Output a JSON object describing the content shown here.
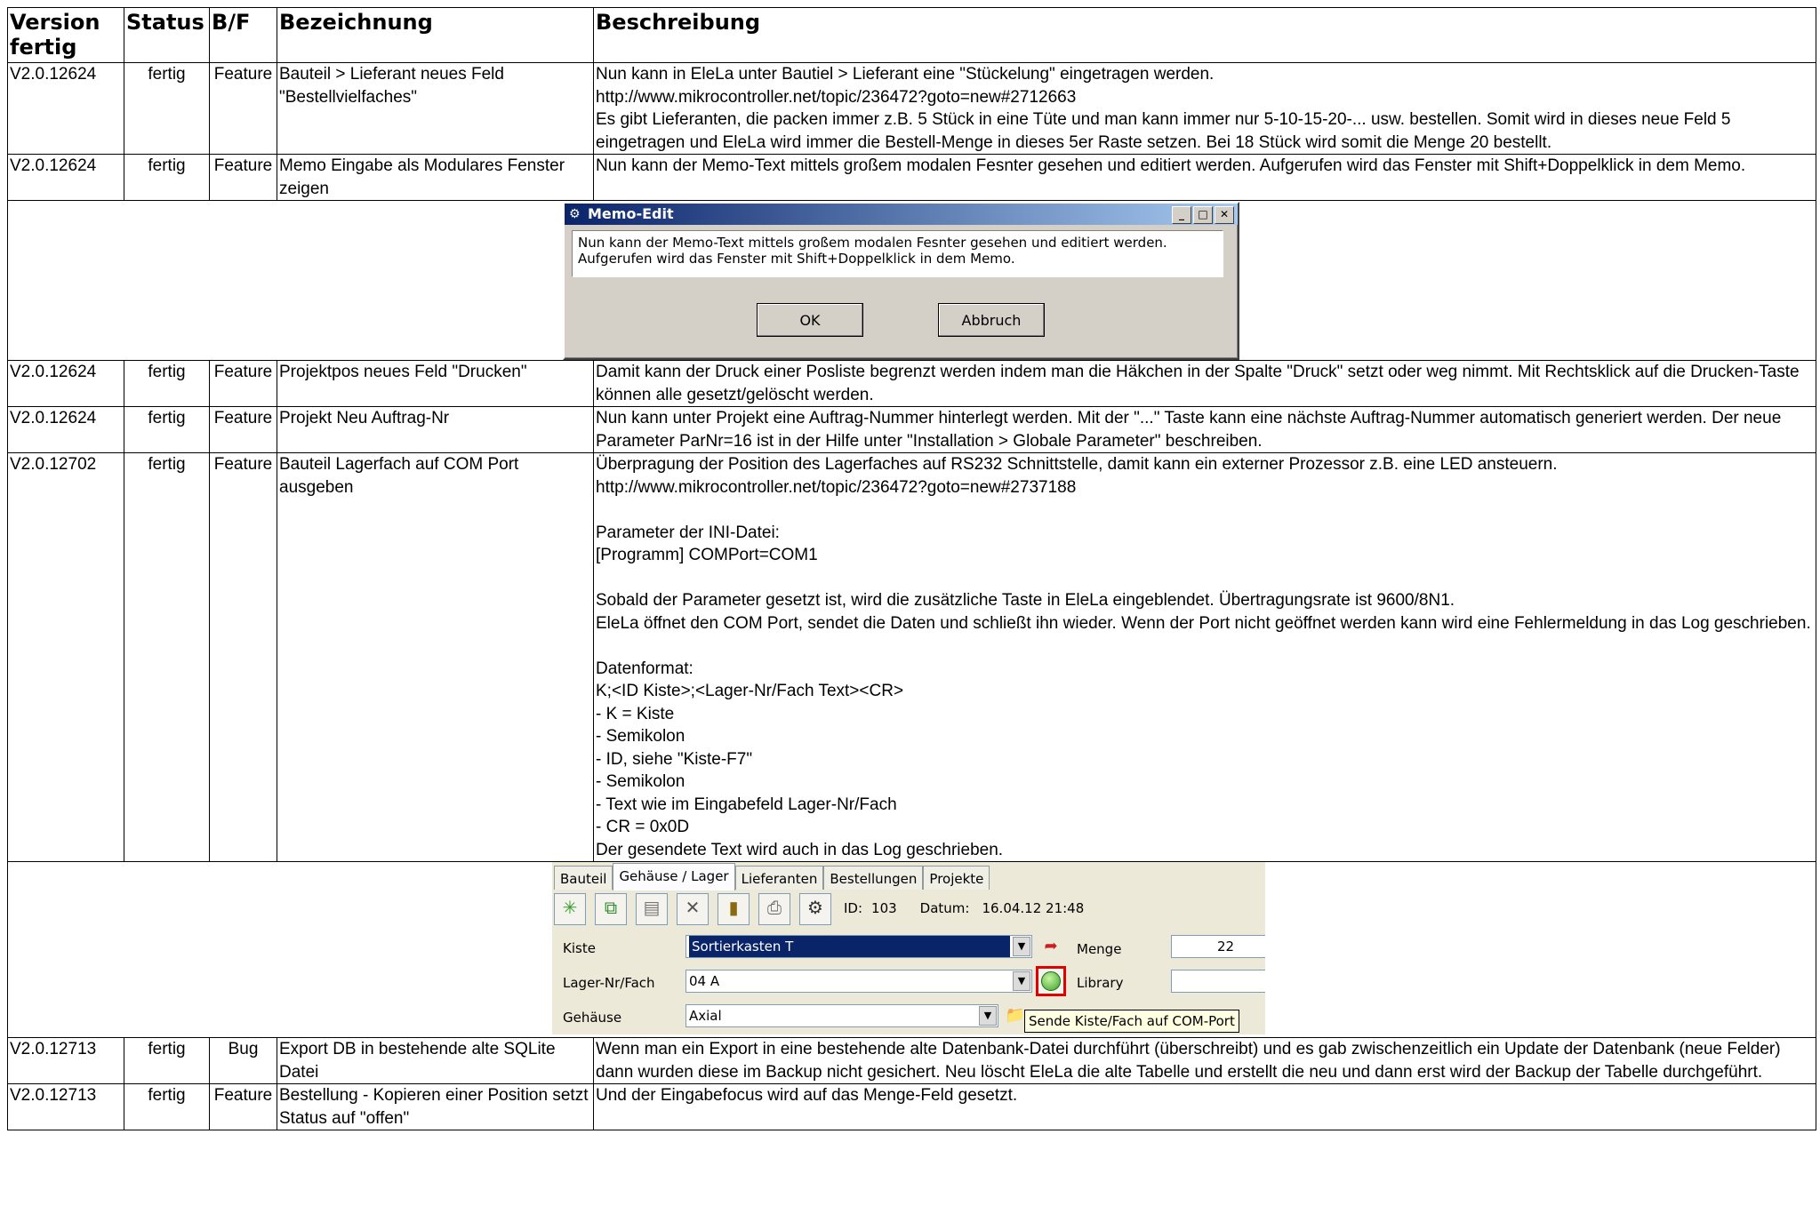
{
  "headers": {
    "version": "Version fertig",
    "status": "Status",
    "bf": "B/F",
    "bezeichnung": "Bezeichnung",
    "beschreibung": "Beschreibung"
  },
  "rows": [
    {
      "version": "V2.0.12624",
      "status": "fertig",
      "bf": "Feature",
      "bezeichnung": "Bauteil > Lieferant neues Feld \"Bestellvielfaches\"",
      "lines": [
        "Nun kann in EleLa unter Bautiel > Lieferant eine \"Stückelung\" eingetragen werden.",
        "http://www.mikrocontroller.net/topic/236472?goto=new#2712663",
        "Es gibt Lieferanten, die packen immer z.B. 5 Stück in eine Tüte und man kann immer nur 5-10-15-20-... usw. bestellen. Somit wird in dieses neue Feld 5 eingetragen und EleLa wird immer die Bestell-Menge in dieses 5er Raste setzen. Bei 18 Stück wird somit die Menge 20 bestellt."
      ]
    },
    {
      "version": "V2.0.12624",
      "status": "fertig",
      "bf": "Feature",
      "bezeichnung": "Memo Eingabe als Modulares Fenster zeigen",
      "lines": [
        "Nun kann der Memo-Text mittels großem modalen Fesnter gesehen und editiert werden. Aufgerufen wird das Fenster mit Shift+Doppelklick in dem Memo."
      ]
    },
    {
      "version": "V2.0.12624",
      "status": "fertig",
      "bf": "Feature",
      "bezeichnung": "Projektpos neues Feld \"Drucken\"",
      "lines": [
        "Damit kann der Druck einer Posliste begrenzt werden indem man die Häkchen in der Spalte \"Druck\" setzt oder weg nimmt. Mit Rechtsklick auf die Drucken-Taste können alle gesetzt/gelöscht werden."
      ]
    },
    {
      "version": "V2.0.12624",
      "status": "fertig",
      "bf": "Feature",
      "bezeichnung": "Projekt Neu Auftrag-Nr",
      "lines": [
        "Nun kann unter Projekt eine Auftrag-Nummer hinterlegt werden. Mit der \"...\" Taste kann eine nächste Auftrag-Nummer automatisch generiert werden. Der neue Parameter ParNr=16 ist in der Hilfe unter \"Installation > Globale Parameter\" beschreiben."
      ]
    },
    {
      "version": "V2.0.12702",
      "status": "fertig",
      "bf": "Feature",
      "bezeichnung": "Bauteil Lagerfach auf COM Port ausgeben",
      "lines": [
        "Überpragung der Position des Lagerfaches auf RS232 Schnittstelle, damit kann ein externer Prozessor z.B. eine LED ansteuern.",
        "http://www.mikrocontroller.net/topic/236472?goto=new#2737188",
        "",
        "Parameter der INI-Datei:",
        "[Programm] COMPort=COM1",
        "",
        "Sobald der Parameter gesetzt ist, wird die zusätzliche Taste in EleLa eingeblendet. Übertragungsrate ist 9600/8N1.",
        "EleLa öffnet den COM Port, sendet die Daten und schließt ihn wieder. Wenn der Port nicht geöffnet werden kann wird eine Fehlermeldung in das Log geschrieben.",
        "",
        "Datenformat:",
        "K;<ID Kiste>;<Lager-Nr/Fach Text><CR>",
        "- K = Kiste",
        "- Semikolon",
        "- ID, siehe \"Kiste-F7\"",
        "- Semikolon",
        "- Text wie im Eingabefeld Lager-Nr/Fach",
        "- CR = 0x0D",
        "Der gesendete Text wird auch in das Log geschrieben."
      ]
    },
    {
      "version": "V2.0.12713",
      "status": "fertig",
      "bf": "Bug",
      "bezeichnung": "Export DB in bestehende alte SQLite Datei",
      "lines": [
        "Wenn man ein Export in eine bestehende alte Datenbank-Datei durchführt (überschreibt) und es gab zwischenzeitlich ein Update der Datenbank (neue Felder) dann wurden diese im Backup nicht gesichert. Neu löscht EleLa die alte Tabelle und erstellt die neu und dann erst wird der Backup der Tabelle durchgeführt."
      ]
    },
    {
      "version": "V2.0.12713",
      "status": "fertig",
      "bf": "Feature",
      "bezeichnung": "Bestellung - Kopieren einer Position setzt Status auf \"offen\"",
      "lines": [
        "Und der Eingabefocus wird auf das Menge-Feld gesetzt."
      ]
    }
  ],
  "memo_dialog": {
    "title": "Memo-Edit",
    "text_lines": [
      "Nun kann der Memo-Text mittels großem modalen Fesnter gesehen und editiert werden.",
      "Aufgerufen wird das Fenster mit Shift+Doppelklick in dem Memo."
    ],
    "ok": "OK",
    "cancel": "Abbruch"
  },
  "panel": {
    "tabs": [
      "Bauteil",
      "Gehäuse / Lager",
      "Lieferanten",
      "Bestellungen",
      "Projekte"
    ],
    "active_tab": "Gehäuse / Lager",
    "id_label": "ID:",
    "id_value": "103",
    "datum_label": "Datum:",
    "datum_value": "16.04.12 21:48",
    "kiste_label": "Kiste",
    "kiste_value": "Sortierkasten T",
    "menge_label": "Menge",
    "menge_value": "22",
    "lager_label": "Lager-Nr/Fach",
    "lager_value": "04 A",
    "library_label": "Library",
    "library_value": "",
    "gehaeuse_label": "Gehäuse",
    "gehaeuse_value": "Axial",
    "tooltip": "Sende Kiste/Fach auf COM-Port",
    "highlight_color": "#e00000"
  }
}
